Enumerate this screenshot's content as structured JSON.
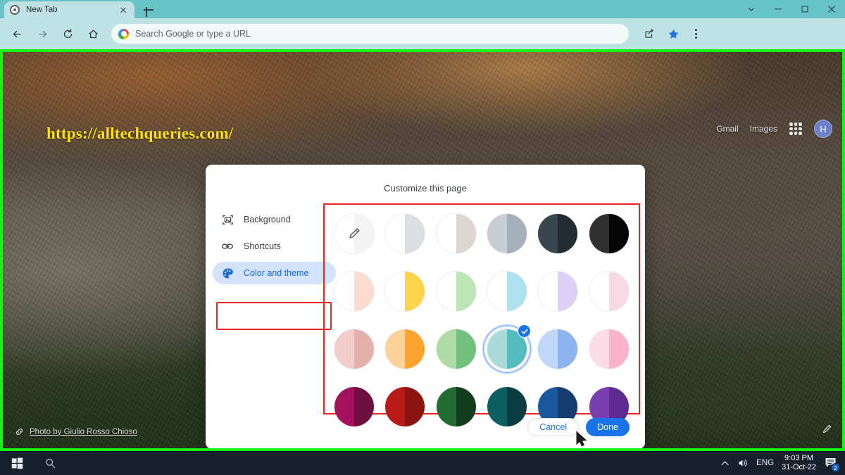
{
  "browser": {
    "tab": {
      "title": "New Tab",
      "favicon_icon": "chrome-favicon",
      "close_icon": "close-icon"
    },
    "new_tab_button_icon": "plus-icon",
    "window_controls": {
      "tab_search_icon": "chevron-down-icon",
      "minimize_icon": "minimize-icon",
      "maximize_icon": "maximize-icon",
      "close_icon": "close-icon"
    },
    "toolbar": {
      "back_icon": "back-arrow-icon",
      "forward_icon": "forward-arrow-icon",
      "reload_icon": "reload-icon",
      "home_icon": "home-icon",
      "omnibox_placeholder": "Search Google or type a URL",
      "omnibox_value": "",
      "google_icon": "google-g-icon",
      "share_icon": "share-icon",
      "bookmark_icon": "star-filled-icon",
      "menu_icon": "three-dot-menu-icon"
    }
  },
  "page": {
    "watermark": "https://alltechqueries.com/",
    "links": [
      {
        "label": "Gmail"
      },
      {
        "label": "Images"
      }
    ],
    "apps_icon": "apps-grid-icon",
    "avatar_letter": "H",
    "photo_credit": "Photo by Giulio Rosso Chioso",
    "photo_credit_icon": "link-icon",
    "customize_icon": "pencil-icon",
    "highlight_border_color": "#16f416"
  },
  "dialog": {
    "title": "Customize this page",
    "sidebar": [
      {
        "label": "Background",
        "icon": "image-frame-icon",
        "active": false
      },
      {
        "label": "Shortcuts",
        "icon": "link-icon",
        "active": false
      },
      {
        "label": "Color and theme",
        "icon": "palette-icon",
        "active": true
      }
    ],
    "highlight_color": "#ef2121",
    "buttons": {
      "cancel": "Cancel",
      "done": "Done"
    },
    "swatches": [
      {
        "name": "custom-color",
        "left": "#ffffff",
        "right": "#f4f4f4",
        "custom": true,
        "selected": false
      },
      {
        "name": "light-grey",
        "left": "#ffffff",
        "right": "#dcdfe1",
        "custom": false,
        "selected": false
      },
      {
        "name": "warm-grey",
        "left": "#ffffff",
        "right": "#ded6d2",
        "custom": false,
        "selected": false
      },
      {
        "name": "cool-grey",
        "left": "#c9cdd4",
        "right": "#a7afbb",
        "custom": false,
        "selected": false
      },
      {
        "name": "dark-slate",
        "left": "#38474f",
        "right": "#222c32",
        "custom": false,
        "selected": false
      },
      {
        "name": "black",
        "left": "#303030",
        "right": "#050505",
        "custom": false,
        "selected": false
      },
      {
        "name": "pale-peach",
        "left": "#ffffff",
        "right": "#fadbce",
        "custom": false,
        "selected": false
      },
      {
        "name": "yellow",
        "left": "#ffffff",
        "right": "#fcd34a",
        "custom": false,
        "selected": false
      },
      {
        "name": "pale-green",
        "left": "#ffffff",
        "right": "#bde5b6",
        "custom": false,
        "selected": false
      },
      {
        "name": "pale-cyan",
        "left": "#ffffff",
        "right": "#aee2ef",
        "custom": false,
        "selected": false
      },
      {
        "name": "pale-lavender",
        "left": "#ffffff",
        "right": "#ddd0f5",
        "custom": false,
        "selected": false
      },
      {
        "name": "pale-pink",
        "left": "#ffffff",
        "right": "#f6d9e5",
        "custom": false,
        "selected": false
      },
      {
        "name": "rose",
        "left": "#f3cdcb",
        "right": "#e3b0ab",
        "custom": false,
        "selected": false
      },
      {
        "name": "orange",
        "left": "#fcd29a",
        "right": "#fca52e",
        "custom": false,
        "selected": false
      },
      {
        "name": "green",
        "left": "#aedaa6",
        "right": "#73c07e",
        "custom": false,
        "selected": false
      },
      {
        "name": "teal",
        "left": "#a8dbd9",
        "right": "#52bcbe",
        "custom": false,
        "selected": true
      },
      {
        "name": "light-blue",
        "left": "#c0d7f7",
        "right": "#8cb4ee",
        "custom": false,
        "selected": false
      },
      {
        "name": "pink",
        "left": "#fcdce6",
        "right": "#fbb3cb",
        "custom": false,
        "selected": false
      },
      {
        "name": "magenta",
        "left": "#a5115e",
        "right": "#6f0f3d",
        "custom": false,
        "selected": false
      },
      {
        "name": "red",
        "left": "#b61b17",
        "right": "#8b1310",
        "custom": false,
        "selected": false
      },
      {
        "name": "forest-green",
        "left": "#226b32",
        "right": "#123c1c",
        "custom": false,
        "selected": false
      },
      {
        "name": "dark-teal",
        "left": "#0b5f60",
        "right": "#093d42",
        "custom": false,
        "selected": false
      },
      {
        "name": "blue",
        "left": "#17599c",
        "right": "#123d6e",
        "custom": false,
        "selected": false
      },
      {
        "name": "purple",
        "left": "#7a3fae",
        "right": "#5f2a90",
        "custom": false,
        "selected": false
      }
    ]
  },
  "taskbar": {
    "start_icon": "windows-start-icon",
    "search_icon": "search-icon",
    "chevron_icon": "chevron-up-icon",
    "volume_icon": "volume-icon",
    "language": "ENG",
    "time": "9:03 PM",
    "date": "31-Oct-22",
    "notification_icon": "notification-icon",
    "notification_count": "2"
  }
}
